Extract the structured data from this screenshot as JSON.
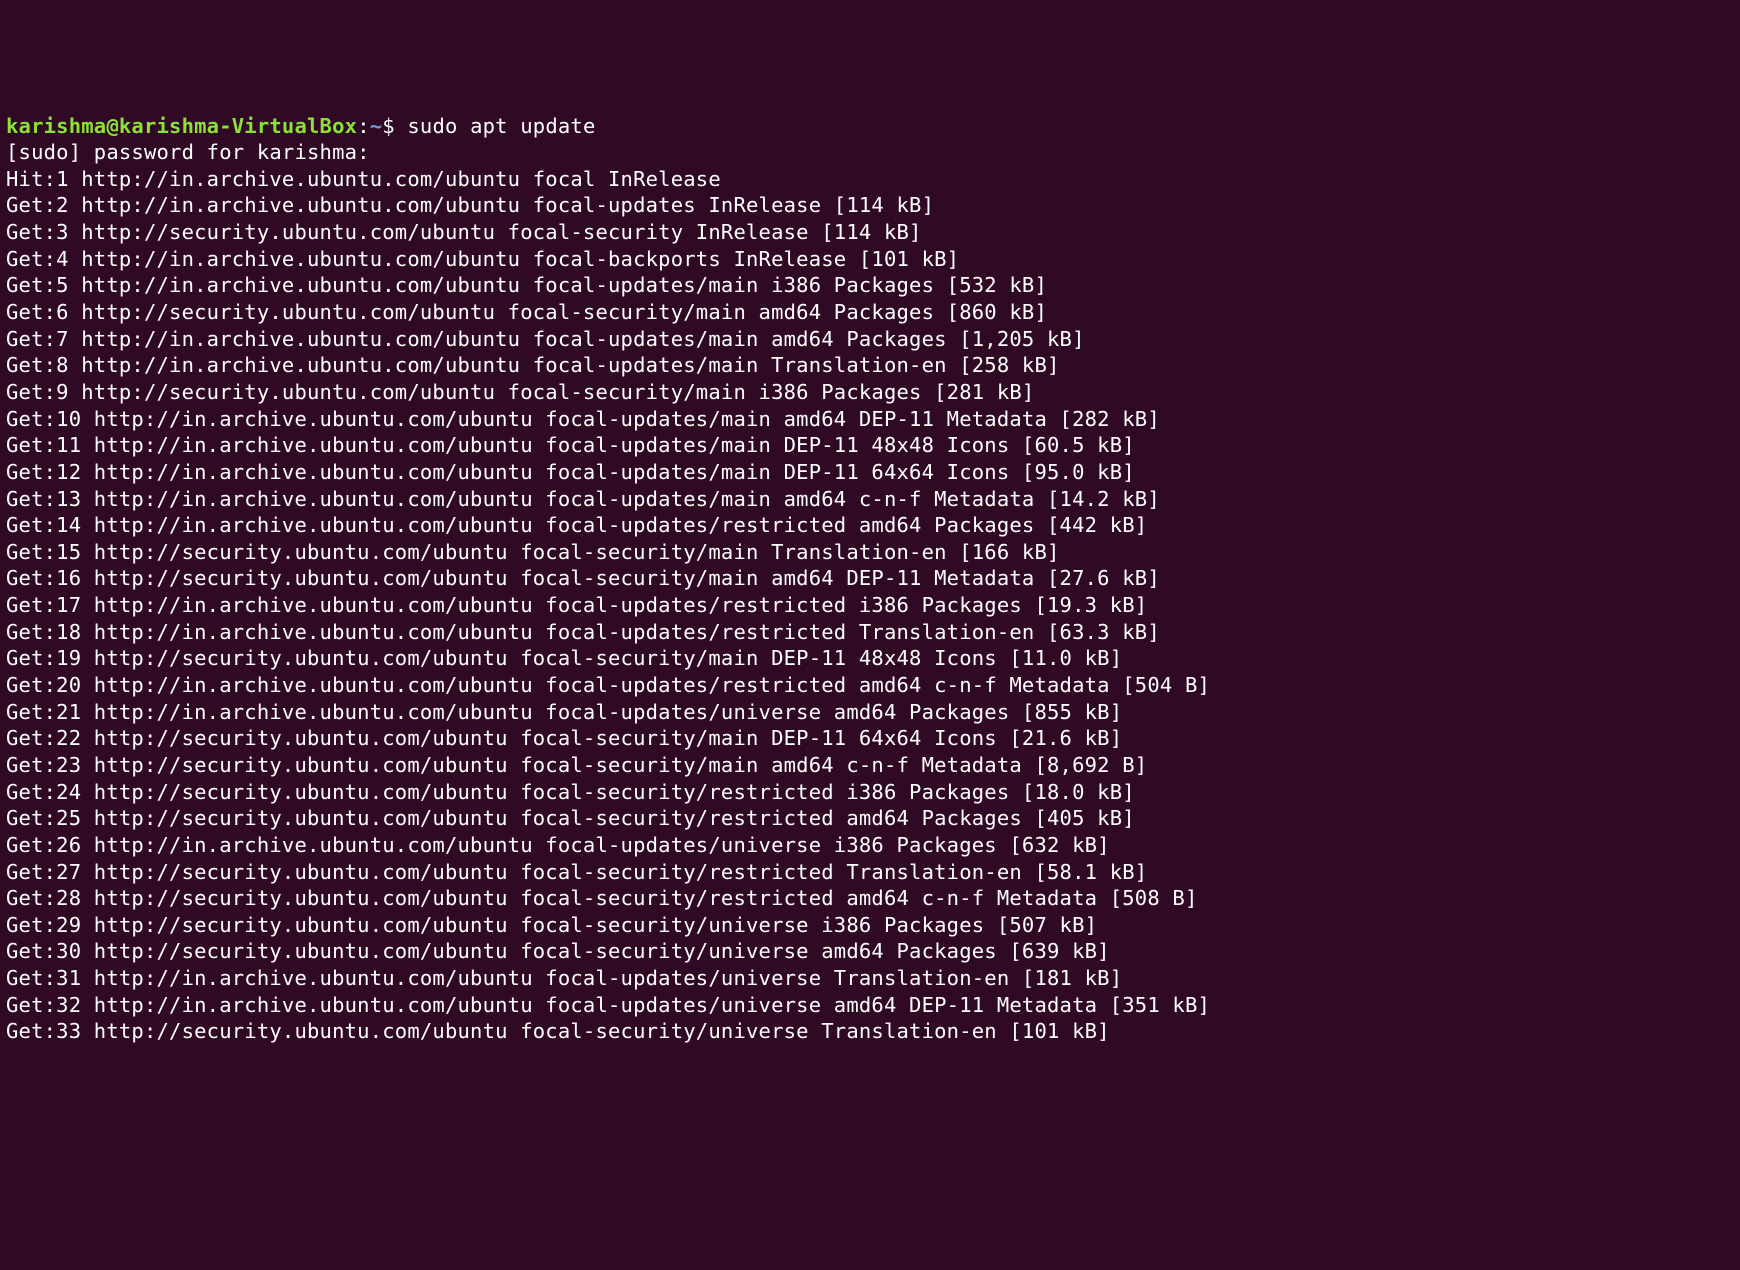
{
  "prompt": {
    "user_host": "karishma@karishma-VirtualBox",
    "separator": ":",
    "path": "~",
    "dollar": "$ ",
    "command": "sudo apt update"
  },
  "sudo_prompt": "[sudo] password for karishma:",
  "lines": [
    "Hit:1 http://in.archive.ubuntu.com/ubuntu focal InRelease",
    "Get:2 http://in.archive.ubuntu.com/ubuntu focal-updates InRelease [114 kB]",
    "Get:3 http://security.ubuntu.com/ubuntu focal-security InRelease [114 kB]",
    "Get:4 http://in.archive.ubuntu.com/ubuntu focal-backports InRelease [101 kB]",
    "Get:5 http://in.archive.ubuntu.com/ubuntu focal-updates/main i386 Packages [532 kB]",
    "Get:6 http://security.ubuntu.com/ubuntu focal-security/main amd64 Packages [860 kB]",
    "Get:7 http://in.archive.ubuntu.com/ubuntu focal-updates/main amd64 Packages [1,205 kB]",
    "Get:8 http://in.archive.ubuntu.com/ubuntu focal-updates/main Translation-en [258 kB]",
    "Get:9 http://security.ubuntu.com/ubuntu focal-security/main i386 Packages [281 kB]",
    "Get:10 http://in.archive.ubuntu.com/ubuntu focal-updates/main amd64 DEP-11 Metadata [282 kB]",
    "Get:11 http://in.archive.ubuntu.com/ubuntu focal-updates/main DEP-11 48x48 Icons [60.5 kB]",
    "Get:12 http://in.archive.ubuntu.com/ubuntu focal-updates/main DEP-11 64x64 Icons [95.0 kB]",
    "Get:13 http://in.archive.ubuntu.com/ubuntu focal-updates/main amd64 c-n-f Metadata [14.2 kB]",
    "Get:14 http://in.archive.ubuntu.com/ubuntu focal-updates/restricted amd64 Packages [442 kB]",
    "Get:15 http://security.ubuntu.com/ubuntu focal-security/main Translation-en [166 kB]",
    "Get:16 http://security.ubuntu.com/ubuntu focal-security/main amd64 DEP-11 Metadata [27.6 kB]",
    "Get:17 http://in.archive.ubuntu.com/ubuntu focal-updates/restricted i386 Packages [19.3 kB]",
    "Get:18 http://in.archive.ubuntu.com/ubuntu focal-updates/restricted Translation-en [63.3 kB]",
    "Get:19 http://security.ubuntu.com/ubuntu focal-security/main DEP-11 48x48 Icons [11.0 kB]",
    "Get:20 http://in.archive.ubuntu.com/ubuntu focal-updates/restricted amd64 c-n-f Metadata [504 B]",
    "Get:21 http://in.archive.ubuntu.com/ubuntu focal-updates/universe amd64 Packages [855 kB]",
    "Get:22 http://security.ubuntu.com/ubuntu focal-security/main DEP-11 64x64 Icons [21.6 kB]",
    "Get:23 http://security.ubuntu.com/ubuntu focal-security/main amd64 c-n-f Metadata [8,692 B]",
    "Get:24 http://security.ubuntu.com/ubuntu focal-security/restricted i386 Packages [18.0 kB]",
    "Get:25 http://security.ubuntu.com/ubuntu focal-security/restricted amd64 Packages [405 kB]",
    "Get:26 http://in.archive.ubuntu.com/ubuntu focal-updates/universe i386 Packages [632 kB]",
    "Get:27 http://security.ubuntu.com/ubuntu focal-security/restricted Translation-en [58.1 kB]",
    "Get:28 http://security.ubuntu.com/ubuntu focal-security/restricted amd64 c-n-f Metadata [508 B]",
    "Get:29 http://security.ubuntu.com/ubuntu focal-security/universe i386 Packages [507 kB]",
    "Get:30 http://security.ubuntu.com/ubuntu focal-security/universe amd64 Packages [639 kB]",
    "Get:31 http://in.archive.ubuntu.com/ubuntu focal-updates/universe Translation-en [181 kB]",
    "Get:32 http://in.archive.ubuntu.com/ubuntu focal-updates/universe amd64 DEP-11 Metadata [351 kB]",
    "Get:33 http://security.ubuntu.com/ubuntu focal-security/universe Translation-en [101 kB]"
  ]
}
